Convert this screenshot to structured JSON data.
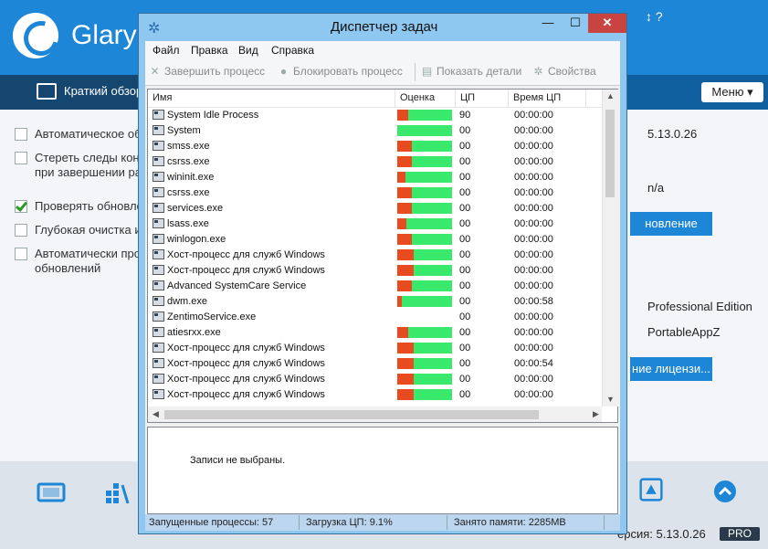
{
  "background_app": {
    "title": "Glary",
    "top_right_text": "↕ ?",
    "tab_label": "Краткий обзор",
    "menu_button": "Меню ▾",
    "options": [
      {
        "label": "Автоматическое об",
        "checked": false
      },
      {
        "label": "Стереть следы конф\nпри завершении раб",
        "checked": false
      },
      {
        "label": "Проверять обновле",
        "checked": true
      },
      {
        "label": "Глубокая очистка и",
        "checked": false
      },
      {
        "label": "Автоматически про\nобновлений",
        "checked": false
      }
    ],
    "right_values": {
      "version_value": "5.13.0.26",
      "na_value": "n/a",
      "update_button": "новление",
      "edition": "Professional Edition",
      "portable": "PortableAppZ",
      "license_button": "ние лицензи..."
    },
    "footer_version": "ерсия: 5.13.0.26",
    "footer_badge": "PRO"
  },
  "window": {
    "title": "Диспетчер задач",
    "minimize": "—",
    "maximize": "☐",
    "close": "✕",
    "menu": [
      "Файл",
      "Правка",
      "Вид",
      "Справка"
    ],
    "toolbar": {
      "end_process": "Завершить процесс",
      "block_process": "Блокировать процесс",
      "show_details": "Показать детали",
      "properties": "Свойства"
    },
    "columns": [
      "Имя",
      "Оценка",
      "ЦП",
      "Время ЦП"
    ],
    "processes": [
      {
        "name": "System Idle Process",
        "rating": 0.2,
        "cpu": "90",
        "time": "00:00:00"
      },
      {
        "name": "System",
        "rating": 0.0,
        "cpu": "00",
        "time": "00:00:00"
      },
      {
        "name": "smss.exe",
        "rating": 0.27,
        "cpu": "00",
        "time": "00:00:00"
      },
      {
        "name": "csrss.exe",
        "rating": 0.27,
        "cpu": "00",
        "time": "00:00:00"
      },
      {
        "name": "wininit.exe",
        "rating": 0.15,
        "cpu": "00",
        "time": "00:00:00"
      },
      {
        "name": "csrss.exe",
        "rating": 0.27,
        "cpu": "00",
        "time": "00:00:00"
      },
      {
        "name": "services.exe",
        "rating": 0.27,
        "cpu": "00",
        "time": "00:00:00"
      },
      {
        "name": "lsass.exe",
        "rating": 0.17,
        "cpu": "00",
        "time": "00:00:00"
      },
      {
        "name": "winlogon.exe",
        "rating": 0.27,
        "cpu": "00",
        "time": "00:00:00"
      },
      {
        "name": "Хост-процесс для служб Windows",
        "rating": 0.3,
        "cpu": "00",
        "time": "00:00:00"
      },
      {
        "name": "Хост-процесс для служб Windows",
        "rating": 0.3,
        "cpu": "00",
        "time": "00:00:00"
      },
      {
        "name": "Advanced SystemCare Service",
        "rating": 0.27,
        "cpu": "00",
        "time": "00:00:00"
      },
      {
        "name": "dwm.exe",
        "rating": 0.08,
        "cpu": "00",
        "time": "00:00:58"
      },
      {
        "name": "ZentimoService.exe",
        "rating": null,
        "cpu": "00",
        "time": "00:00:00"
      },
      {
        "name": "atiesrxx.exe",
        "rating": 0.2,
        "cpu": "00",
        "time": "00:00:00"
      },
      {
        "name": "Хост-процесс для служб Windows",
        "rating": 0.3,
        "cpu": "00",
        "time": "00:00:00"
      },
      {
        "name": "Хост-процесс для служб Windows",
        "rating": 0.3,
        "cpu": "00",
        "time": "00:00:54"
      },
      {
        "name": "Хост-процесс для служб Windows",
        "rating": 0.3,
        "cpu": "00",
        "time": "00:00:00"
      },
      {
        "name": "Хост-процесс для служб Windows",
        "rating": 0.3,
        "cpu": "00",
        "time": "00:00:00"
      }
    ],
    "detail_text": "Записи не выбраны.",
    "status": {
      "processes": "Запущенные процессы: 57",
      "cpu_load": "Загрузка ЦП: 9.1%",
      "memory": "Занято памяти: 2285MB"
    }
  },
  "colors": {
    "rating_good": "#39e96b",
    "rating_bad": "#e84b1f",
    "accent": "#1e86d6"
  }
}
